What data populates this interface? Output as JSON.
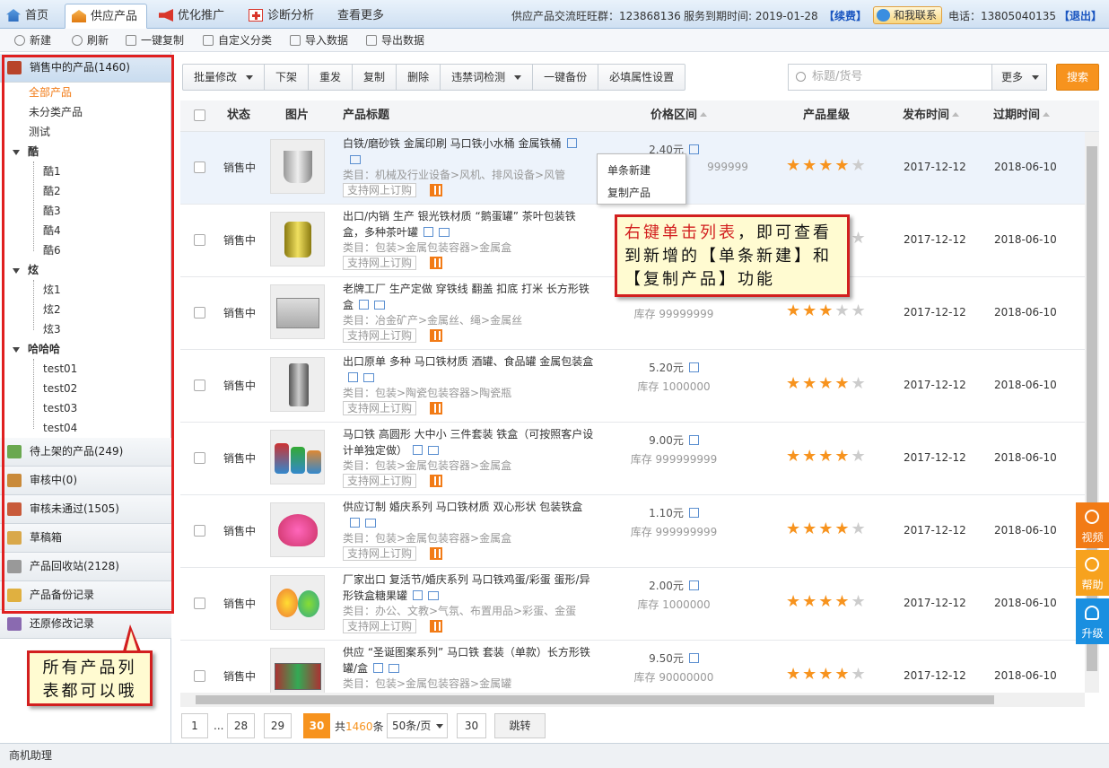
{
  "tabs": [
    {
      "label": "首页",
      "icon": "home-icon"
    },
    {
      "label": "供应产品",
      "icon": "supply-icon"
    },
    {
      "label": "优化推广",
      "icon": "megaphone-icon"
    },
    {
      "label": "诊断分析",
      "icon": "medical-kit-icon"
    },
    {
      "label": "查看更多",
      "icon": ""
    }
  ],
  "header": {
    "group_label": "供应产品交流旺旺群：123868136",
    "expire_label": "服务到期时间: 2019-01-28",
    "renew": "【续费】",
    "contact": "和我联系",
    "phone": "电话：13805040135",
    "logout": "【退出】"
  },
  "toolbar": {
    "new": "新建",
    "refresh": "刷新",
    "copy_all": "一键复制",
    "custom_category": "自定义分类",
    "import": "导入数据",
    "export": "导出数据"
  },
  "sidebar": {
    "on_sale": "销售中的产品(1460)",
    "all_products": "全部产品",
    "uncategorized": "未分类产品",
    "test": "测试",
    "groups": [
      {
        "name": "酷",
        "items": [
          "酷1",
          "酷2",
          "酷3",
          "酷4",
          "酷6"
        ]
      },
      {
        "name": "炫",
        "items": [
          "炫1",
          "炫2",
          "炫3"
        ]
      },
      {
        "name": "哈哈哈",
        "items": [
          "test01",
          "test02",
          "test03",
          "test04"
        ]
      }
    ],
    "pending": "待上架的产品(249)",
    "reviewing": "审核中(0)",
    "rejected": "审核未通过(1505)",
    "drafts": "草稿箱",
    "recycle": "产品回收站(2128)",
    "backup": "产品备份记录",
    "restore": "还原修改记录"
  },
  "actions": {
    "batch_edit": "批量修改",
    "offshelf": "下架",
    "repost": "重发",
    "copy": "复制",
    "delete": "删除",
    "banned_check": "违禁词检测",
    "backup": "一键备份",
    "required_attrs": "必填属性设置"
  },
  "search": {
    "placeholder": "标题/货号",
    "more": "更多",
    "button": "搜索"
  },
  "table_headers": {
    "status": "状态",
    "image": "图片",
    "title": "产品标题",
    "price": "价格区间",
    "stars": "产品星级",
    "publish": "发布时间",
    "expire": "过期时间"
  },
  "products": [
    {
      "status": "销售中",
      "title": "白铁/磨砂铁 金属印刷 马口铁小水桶 金属铁桶",
      "category": "类目：机械及行业设备>风机、排风设备>风管",
      "order": "支持网上订购",
      "price": "2.40元",
      "stock": "999999",
      "rating": 4,
      "publish": "2017-12-12",
      "expire": "2018-06-10"
    },
    {
      "status": "销售中",
      "title": "出口/内销 生产 银光铁材质 “鹅蛋罐” 茶叶包装铁盒，多种茶叶罐",
      "category": "类目：包装>金属包装容器>金属盒",
      "order": "支持网上订购",
      "price": "",
      "stock": "",
      "rating": 4,
      "publish": "2017-12-12",
      "expire": "2018-06-10"
    },
    {
      "status": "销售中",
      "title": "老牌工厂 生产定做 穿铁线 翻盖 扣底 打米 长方形铁盒",
      "category": "类目：冶金矿产>金属丝、绳>金属丝",
      "order": "支持网上订购",
      "price": "",
      "stock": "库存 99999999",
      "rating": 3,
      "publish": "2017-12-12",
      "expire": "2018-06-10"
    },
    {
      "status": "销售中",
      "title": "出口原单 多种 马口铁材质 酒罐、食品罐 金属包装盒",
      "category": "类目：包装>陶瓷包装容器>陶瓷瓶",
      "order": "支持网上订购",
      "price": "5.20元",
      "stock": "库存 1000000",
      "rating": 4,
      "publish": "2017-12-12",
      "expire": "2018-06-10"
    },
    {
      "status": "销售中",
      "title": "马口铁 高圆形 大中小 三件套装 铁盒（可按照客户设计单独定做）",
      "category": "类目：包装>金属包装容器>金属盒",
      "order": "支持网上订购",
      "price": "9.00元",
      "stock": "库存 999999999",
      "rating": 4,
      "publish": "2017-12-12",
      "expire": "2018-06-10"
    },
    {
      "status": "销售中",
      "title": "供应订制 婚庆系列 马口铁材质 双心形状 包装铁盒",
      "category": "类目：包装>金属包装容器>金属盒",
      "order": "支持网上订购",
      "price": "1.10元",
      "stock": "库存 999999999",
      "rating": 4,
      "publish": "2017-12-12",
      "expire": "2018-06-10"
    },
    {
      "status": "销售中",
      "title": "厂家出口 复活节/婚庆系列 马口铁鸡蛋/彩蛋 蛋形/异形铁盒糖果罐",
      "category": "类目：办公、文教>气氛、布置用品>彩蛋、金蛋",
      "order": "支持网上订购",
      "price": "2.00元",
      "stock": "库存 1000000",
      "rating": 4,
      "publish": "2017-12-12",
      "expire": "2018-06-10"
    },
    {
      "status": "销售中",
      "title": "供应 “圣诞图案系列” 马口铁 套装（单款）长方形铁罐/盒",
      "category": "类目：包装>金属包装容器>金属罐",
      "order": "",
      "price": "9.50元",
      "stock": "库存 90000000",
      "rating": 4,
      "publish": "2017-12-12",
      "expire": "2018-06-10"
    }
  ],
  "context_menu": {
    "single_new": "单条新建",
    "copy_product": "复制产品"
  },
  "callouts": {
    "right_click_red": "右键单击列表",
    "right_click_rest": "，即可查看到新增的【单条新建】和【复制产品】功能",
    "all_lists": "所有产品列表都可以哦"
  },
  "pagination": {
    "first": "1",
    "ellipsis": "...",
    "p28": "28",
    "p29": "29",
    "current": "30",
    "total_prefix": "共",
    "total": "1460",
    "total_suffix": "条",
    "per_page": "50条/页",
    "jump_value": "30",
    "jump": "跳转"
  },
  "float_buttons": {
    "video": "视频",
    "help": "帮助",
    "upgrade": "升级"
  },
  "statusbar": "商机助理",
  "colors": {
    "accent": "#f7931e",
    "link": "#1a55c0",
    "callout_border": "#d21f1f"
  }
}
